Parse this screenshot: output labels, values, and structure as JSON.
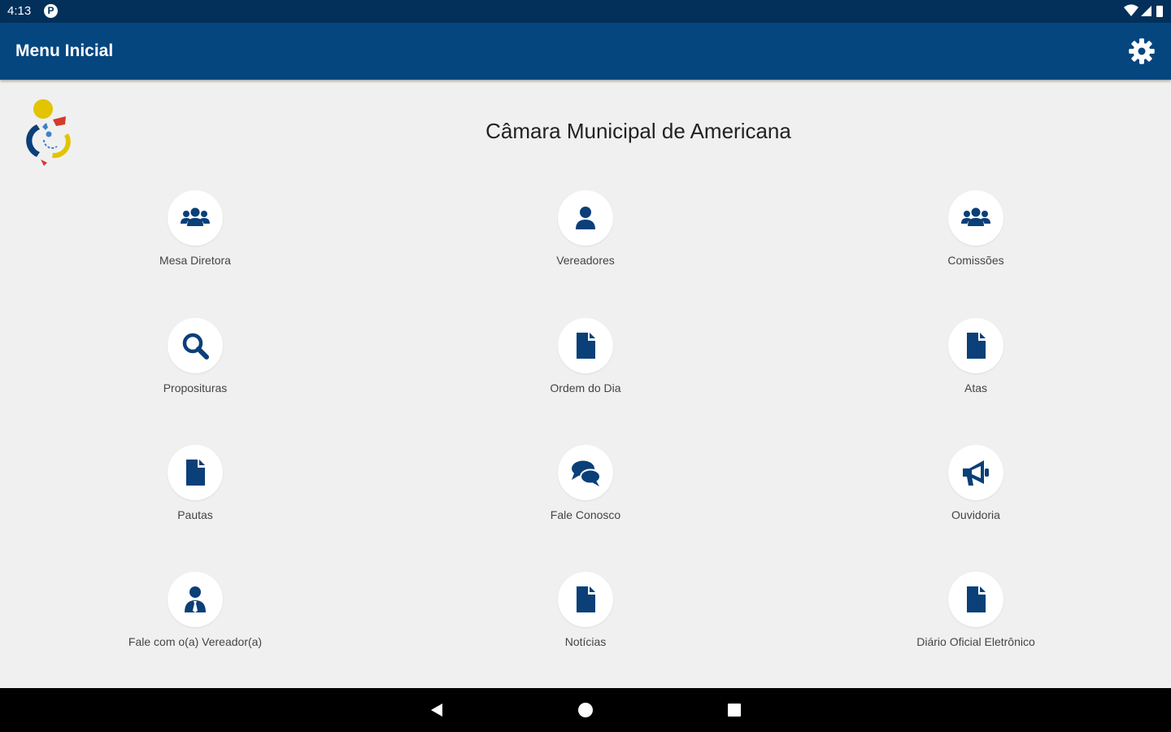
{
  "status_bar": {
    "time": "4:13",
    "notification_letter": "P"
  },
  "app_bar": {
    "title": "Menu Inicial",
    "settings_icon": "gear-icon"
  },
  "header": {
    "org_name": "Câmara Municipal de Americana"
  },
  "menu": {
    "items": [
      {
        "label": "Mesa Diretora",
        "icon": "users-icon"
      },
      {
        "label": "Vereadores",
        "icon": "user-icon"
      },
      {
        "label": "Comissões",
        "icon": "users-icon"
      },
      {
        "label": "Proposituras",
        "icon": "search-icon"
      },
      {
        "label": "Ordem do Dia",
        "icon": "file-icon"
      },
      {
        "label": "Atas",
        "icon": "file-icon"
      },
      {
        "label": "Pautas",
        "icon": "file-icon"
      },
      {
        "label": "Fale Conosco",
        "icon": "comments-icon"
      },
      {
        "label": "Ouvidoria",
        "icon": "megaphone-icon"
      },
      {
        "label": "Fale com o(a) Vereador(a)",
        "icon": "user-tie-icon"
      },
      {
        "label": "Notícias",
        "icon": "file-icon"
      },
      {
        "label": "Diário Oficial Eletrônico",
        "icon": "file-icon"
      }
    ]
  },
  "colors": {
    "status_bar": "#03305a",
    "app_bar": "#05467f",
    "icon_color": "#0a3f78",
    "background": "#f0f0f0",
    "nav_bar": "#000000"
  }
}
